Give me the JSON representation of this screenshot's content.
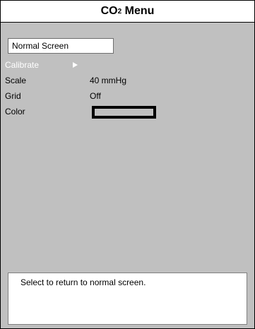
{
  "window": {
    "title_main": "CO",
    "title_sub": "2",
    "title_tail": " Menu"
  },
  "menu": {
    "items": [
      {
        "label": "Normal Screen",
        "state": "selected"
      },
      {
        "label": "Calibrate",
        "state": "disabled",
        "icon": "submenu-arrow-icon"
      },
      {
        "label": "Scale",
        "value": "40 mmHg"
      },
      {
        "label": "Grid",
        "value": "Off"
      },
      {
        "label": "Color",
        "value_type": "swatch",
        "swatch_color": "#c0c0c0"
      }
    ]
  },
  "help": {
    "text": "Select to return to normal screen."
  },
  "colors": {
    "background": "#c0c0c0",
    "panel": "#ffffff",
    "disabled_text": "#ffffff"
  }
}
